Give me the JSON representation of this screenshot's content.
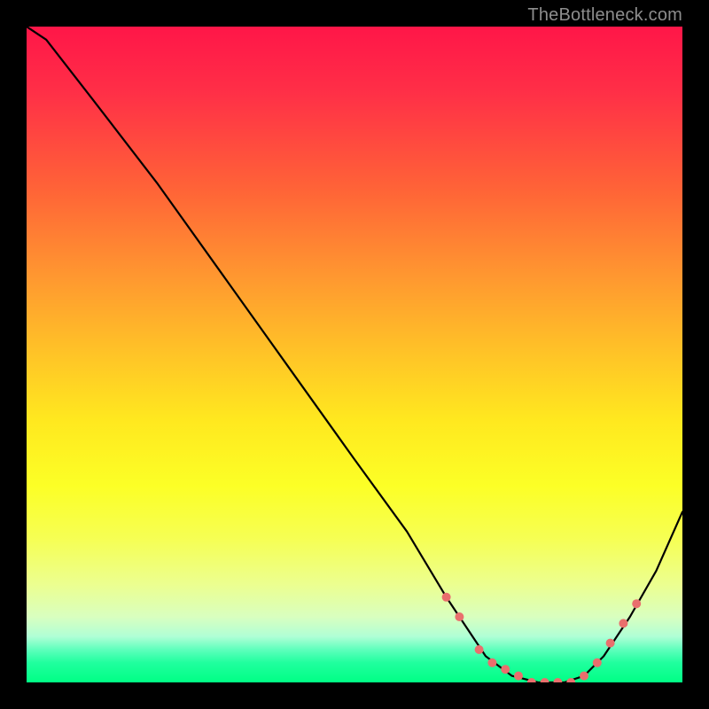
{
  "attribution": "TheBottleneck.com",
  "chart_data": {
    "type": "line",
    "title": "",
    "xlabel": "",
    "ylabel": "",
    "xlim": [
      0,
      100
    ],
    "ylim": [
      0,
      100
    ],
    "grid": false,
    "legend": false,
    "background_gradient": {
      "top_color": "#ff1648",
      "bottom_color": "#00ff85",
      "description": "vertical traffic-light gradient (red→orange→yellow→green)"
    },
    "series": [
      {
        "name": "bottleneck-curve",
        "color": "#000000",
        "x": [
          0,
          3,
          10,
          20,
          30,
          40,
          50,
          58,
          64,
          66,
          70,
          74,
          78,
          82,
          85,
          88,
          92,
          96,
          100
        ],
        "y": [
          100,
          98,
          89,
          76,
          62,
          48,
          34,
          23,
          13,
          10,
          4,
          1,
          0,
          0,
          1,
          4,
          10,
          17,
          26
        ]
      }
    ],
    "markers": {
      "name": "highlighted-points",
      "color": "#e96f6d",
      "radius_px": 5,
      "x": [
        64,
        66,
        69,
        71,
        73,
        75,
        77,
        79,
        81,
        83,
        85,
        87,
        89,
        91,
        93
      ],
      "y": [
        13,
        10,
        5,
        3,
        2,
        1,
        0,
        0,
        0,
        0,
        1,
        3,
        6,
        9,
        12
      ]
    }
  }
}
